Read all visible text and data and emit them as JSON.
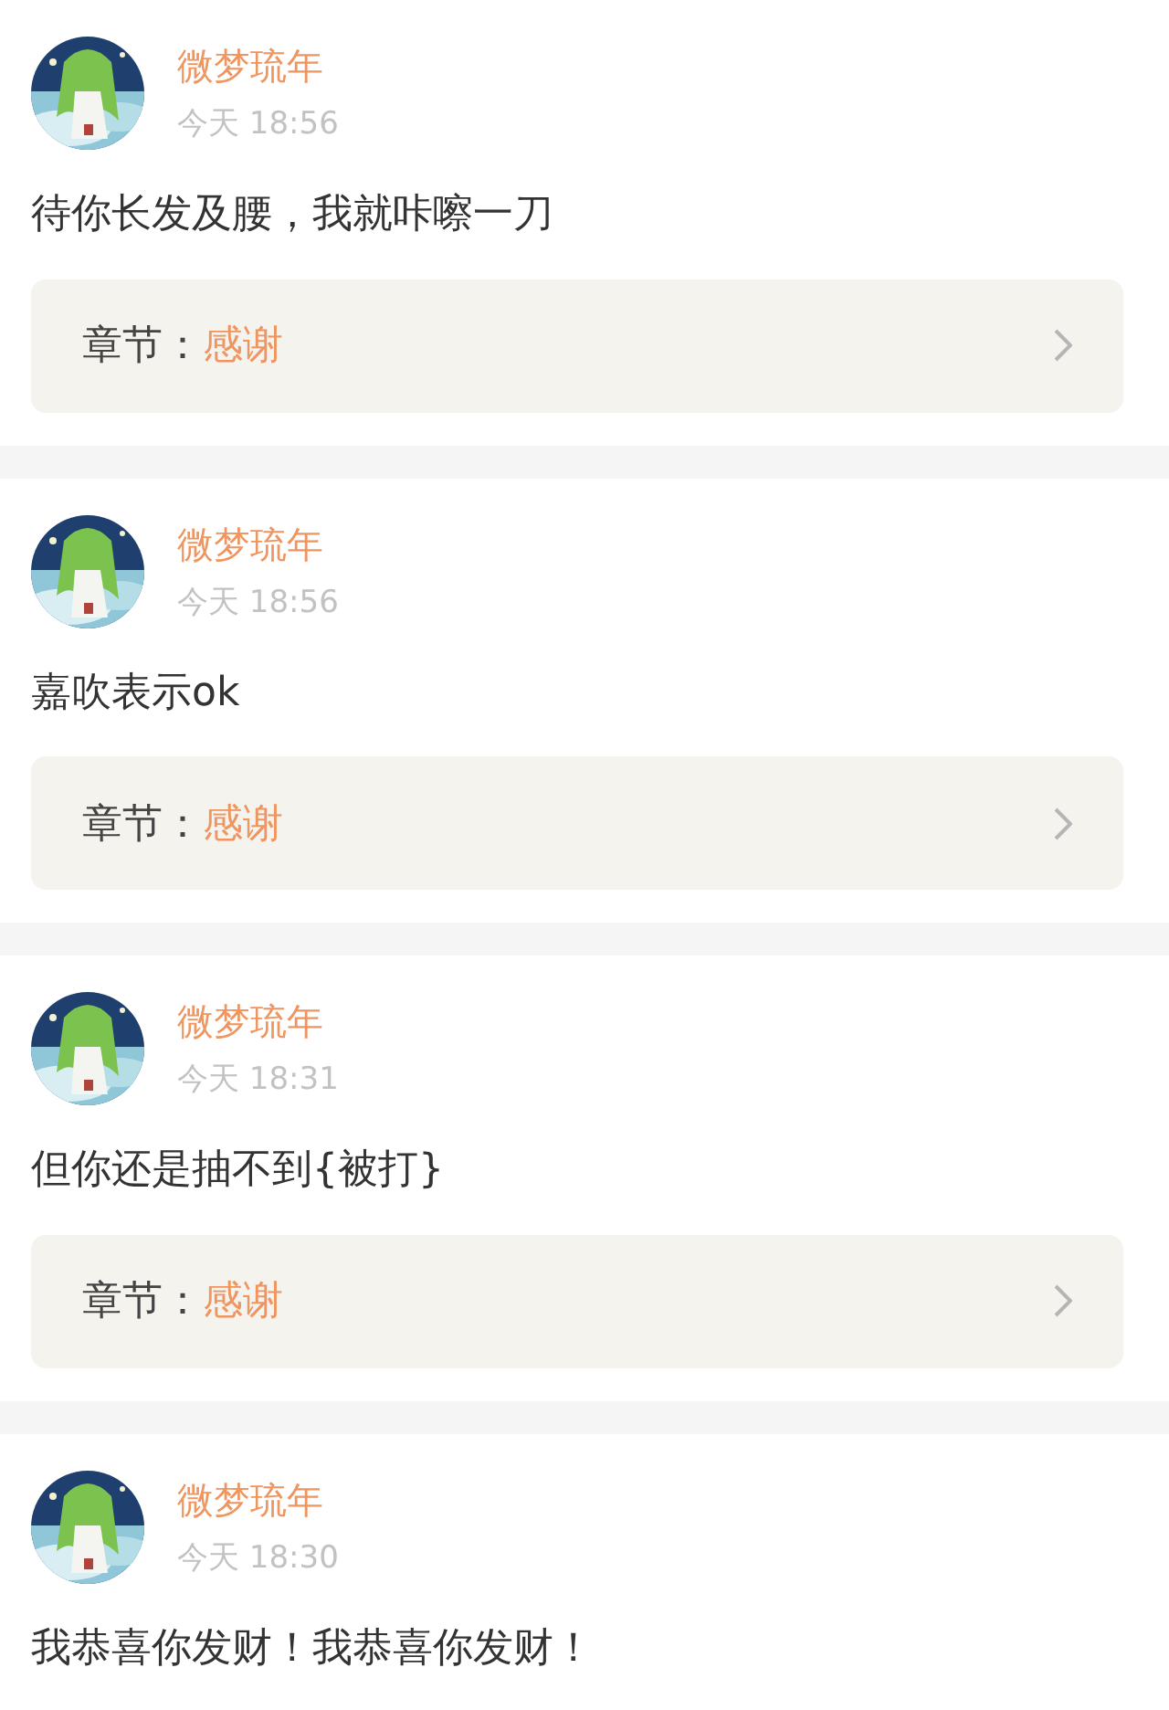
{
  "comments": [
    {
      "user": "微梦琉年",
      "time": "今天 18:56",
      "text": "待你长发及腰，我就咔嚓一刀",
      "chapter": {
        "label": "章节：",
        "name": "感谢"
      }
    },
    {
      "user": "微梦琉年",
      "time": "今天 18:56",
      "text": "嘉吹表示ok",
      "chapter": {
        "label": "章节：",
        "name": "感谢"
      }
    },
    {
      "user": "微梦琉年",
      "time": "今天 18:31",
      "text": "但你还是抽不到{被打}",
      "chapter": {
        "label": "章节：",
        "name": "感谢"
      }
    },
    {
      "user": "微梦琉年",
      "time": "今天 18:30",
      "text": "我恭喜你发财！我恭喜你发财！"
    }
  ]
}
